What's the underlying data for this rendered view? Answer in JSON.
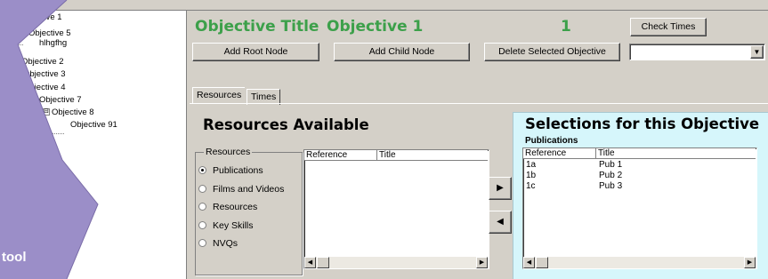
{
  "tree": {
    "items": [
      {
        "label": "Objective 1",
        "toggle": "⊟"
      },
      {
        "label": "Objective 5",
        "toggle": ""
      },
      {
        "label": "hlhgfhg",
        "toggle": ""
      },
      {
        "label": "Objective 2",
        "toggle": "⊞"
      },
      {
        "label": "Objective 3",
        "toggle": ""
      },
      {
        "label": "Objective 4",
        "toggle": ""
      },
      {
        "label": "Objective 7",
        "toggle": "⊟"
      },
      {
        "label": "Objective 8",
        "toggle": "⊟"
      },
      {
        "label": "Objective 91",
        "toggle": ""
      }
    ]
  },
  "decoration": {
    "tool_text": "tool"
  },
  "header": {
    "title_label": "Objective Title",
    "title_value": "Objective 1",
    "count": "1",
    "check_times_label": "Check Times",
    "add_root_label": "Add Root Node",
    "add_child_label": "Add Child Node",
    "delete_label": "Delete Selected Objective",
    "dropdown_value": ""
  },
  "tabs": [
    {
      "label": "Resources",
      "active": true
    },
    {
      "label": "Times",
      "active": false
    }
  ],
  "resources": {
    "heading": "Resources Available",
    "group_label": "Resources",
    "radios": [
      {
        "label": "Publications",
        "selected": true
      },
      {
        "label": "Films and Videos",
        "selected": false
      },
      {
        "label": "Resources",
        "selected": false
      },
      {
        "label": "Key Skills",
        "selected": false
      },
      {
        "label": "NVQs",
        "selected": false
      }
    ],
    "columns": [
      "Reference",
      "Title"
    ],
    "rows": []
  },
  "transfer": {
    "add_glyph": "▶",
    "remove_glyph": "◀"
  },
  "selections": {
    "heading": "Selections for this Objective",
    "subheading": "Publications",
    "columns": [
      "Reference",
      "Title"
    ],
    "rows": [
      {
        "reference": "1a",
        "title": "Pub 1"
      },
      {
        "reference": "1b",
        "title": "Pub 2"
      },
      {
        "reference": "1c",
        "title": "Pub 3"
      }
    ]
  },
  "scrollbar": {
    "left_glyph": "◀",
    "right_glyph": "▶"
  },
  "colors": {
    "title_green": "#3ca04a",
    "selection_bg": "#d6f6fb",
    "purple": "#9b8ec8"
  }
}
